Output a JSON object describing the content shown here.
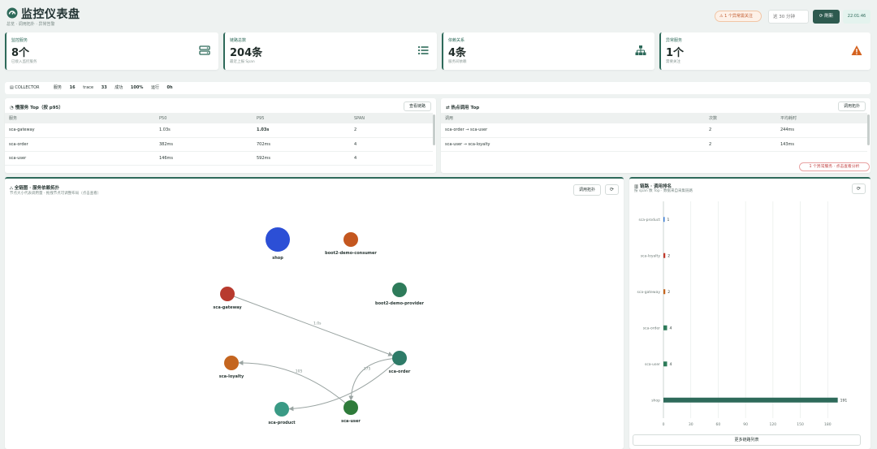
{
  "header": {
    "title": "监控仪表盘",
    "subtitle": "总览 · 调用拓扑 · 异常告警",
    "alert_pill": "1 个异常需关注",
    "search_placeholder": "这 30 分钟",
    "refresh_label": "刷新",
    "clock": "22:01:46"
  },
  "stats": [
    {
      "label": "监控服务",
      "value": "8个",
      "sub": "已接入监控服务",
      "icon": "server-icon"
    },
    {
      "label": "链路总数",
      "value": "204条",
      "sub": "最近上报 Span",
      "icon": "list-icon"
    },
    {
      "label": "依赖关系",
      "value": "4条",
      "sub": "服务间依赖",
      "icon": "sitemap-icon"
    },
    {
      "label": "异常服务",
      "value": "1个",
      "sub": "需要关注",
      "icon": "warning-icon"
    }
  ],
  "collector": {
    "tag": "COLLECTOR",
    "items": [
      {
        "k": "服务",
        "v": "16"
      },
      {
        "k": "trace",
        "v": "33"
      },
      {
        "k": "成功",
        "v": "100%"
      },
      {
        "k": "运行",
        "v": "0h"
      }
    ]
  },
  "slow_panel": {
    "title": "慢服务 Top（按 p95）",
    "button": "查看链路",
    "columns": [
      "服务",
      "P50",
      "P95",
      "SPAN"
    ],
    "rows": [
      [
        "sca-gateway",
        "1.03s",
        "1.03s",
        "2"
      ],
      [
        "sca-order",
        "382ms",
        "702ms",
        "4"
      ],
      [
        "sca-user",
        "146ms",
        "592ms",
        "4"
      ]
    ]
  },
  "hot_panel": {
    "title": "热点调用 Top",
    "button": "调用拓扑",
    "columns": [
      "调用",
      "次数",
      "平均耗时"
    ],
    "rows": [
      [
        "sca-order → sca-user",
        "2",
        "244ms"
      ],
      [
        "sca-user → sca-loyalty",
        "2",
        "143ms"
      ]
    ],
    "error_pill": "1 个异常服务 · 点击查看分析"
  },
  "topology": {
    "title": "全链图 · 服务依赖拓扑",
    "subtitle": "节点大小代表调用量 · 拖拽节点可调整布局（点击查看）",
    "button": "调用拓扑",
    "refresh_icon": "⟳",
    "nodes": [
      {
        "id": "shop",
        "label": "shop",
        "color": "#2c4fd6"
      },
      {
        "id": "boot2-demo-consumer",
        "label": "boot2-demo-consumer",
        "color": "#c4571f"
      },
      {
        "id": "sca-gateway",
        "label": "sca-gateway",
        "color": "#b83a2e"
      },
      {
        "id": "boot2-demo-provider",
        "label": "boot2-demo-provider",
        "color": "#2e7b5a"
      },
      {
        "id": "sca-order",
        "label": "sca-order",
        "color": "#2e7b68"
      },
      {
        "id": "sca-loyalty",
        "label": "sca-loyalty",
        "color": "#c4651f"
      },
      {
        "id": "sca-product",
        "label": "sca-product",
        "color": "#3a9a85"
      },
      {
        "id": "sca-user",
        "label": "sca-user",
        "color": "#2e7b3a"
      }
    ],
    "edges": [
      {
        "from": "sca-gateway",
        "to": "sca-order",
        "label": "1.0s"
      },
      {
        "from": "sca-order",
        "to": "sca-user",
        "label": "175"
      },
      {
        "from": "sca-order",
        "to": "sca-product",
        "label": ""
      },
      {
        "from": "sca-user",
        "to": "sca-loyalty",
        "label": "105"
      }
    ]
  },
  "chart_panel": {
    "title": "链路 · 调用排名",
    "subtitle": "按 span 数 Top · 数据来自采集链路",
    "refresh_icon": "⟳",
    "footer_button": "更多链路列表"
  },
  "chart_data": {
    "type": "bar",
    "orientation": "horizontal",
    "categories": [
      "sca-product",
      "sca-loyalty",
      "sca-gateway",
      "sca-order",
      "sca-user",
      "shop"
    ],
    "values": [
      1,
      2,
      2,
      4,
      4,
      191
    ],
    "xticks": [
      "0",
      "30",
      "60",
      "90",
      "120",
      "150",
      "180"
    ],
    "xlim": [
      0,
      210
    ],
    "bar_colors": [
      "#3a7bd5",
      "#c0392b",
      "#c4651f",
      "#2e7b5a",
      "#2e7b5a",
      "#2e6a5a"
    ],
    "grid": true
  }
}
